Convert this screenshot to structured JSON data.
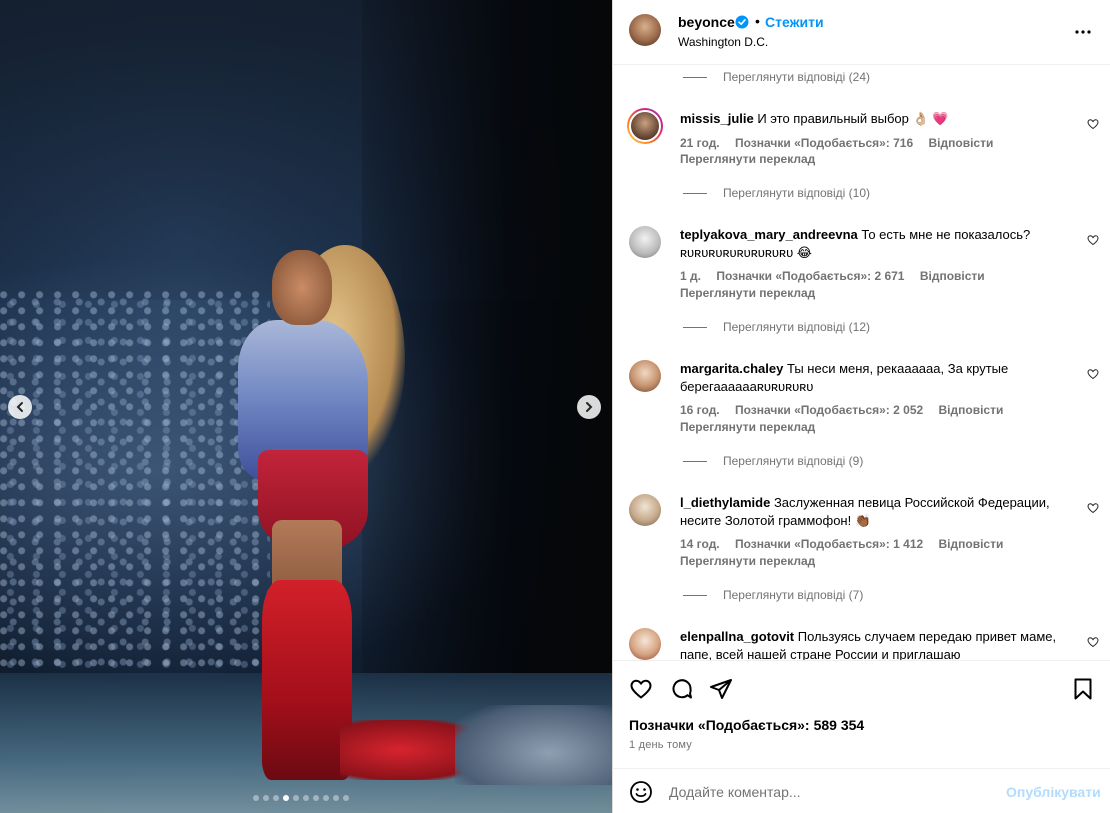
{
  "post": {
    "username": "beyonce",
    "follow_label": "Стежити",
    "separator": "•",
    "location": "Washington D.C."
  },
  "media": {
    "slides_total": 10,
    "active_slide": 4
  },
  "comments": [
    {
      "view_replies": "Переглянути відповіді (24)"
    },
    {
      "username": "missis_julie",
      "text": "И это правильный выбор 👌🏼 💗",
      "time": "21 год.",
      "likes": "Позначки «Подобається»: 716",
      "reply": "Відповісти",
      "translate": "Переглянути переклад",
      "view_replies": "Переглянути відповіді (10)"
    },
    {
      "username": "teplyakova_mary_andreevna",
      "text": "То есть мне не показалось? ʀᴜʀᴜʀᴜʀᴜʀᴜʀᴜʀᴜʀᴜ 😂",
      "time": "1 д.",
      "likes": "Позначки «Подобається»: 2 671",
      "reply": "Відповісти",
      "translate": "Переглянути переклад",
      "view_replies": "Переглянути відповіді (12)"
    },
    {
      "username": "margarita.chaley",
      "text": "Ты неси меня, рекаааааа, За крутые берегааааааʀᴜʀᴜʀᴜʀᴜ",
      "time": "16 год.",
      "likes": "Позначки «Подобається»: 2 052",
      "reply": "Відповісти",
      "translate": "Переглянути переклад",
      "view_replies": "Переглянути відповіді (9)"
    },
    {
      "username": "l_diethylamide",
      "text": "Заслуженная певица Российской Федерации, несите Золотой граммофон! 👏🏾",
      "time": "14 год.",
      "likes": "Позначки «Подобається»: 1 412",
      "reply": "Відповісти",
      "translate": "Переглянути переклад",
      "view_replies": "Переглянути відповіді (7)"
    },
    {
      "username": "elenpallna_gotovit",
      "text": "Пользуясь случаем передаю привет маме, папе, всей нашей стране России и приглашаю"
    }
  ],
  "footer": {
    "likes_label": "Позначки «Подобається»:",
    "likes_count": "589 354",
    "time_ago": "1 день тому",
    "comment_placeholder": "Додайте коментар...",
    "publish_label": "Опублікувати"
  },
  "colors": {
    "accent": "#0095f6",
    "muted": "#737373",
    "publish_disabled": "#b3dbff",
    "heart_emoji": "#e9457a"
  },
  "icons": {
    "verified": "verified-badge-icon",
    "more": "more-dots-icon",
    "like": "heart-icon",
    "comment": "comment-icon",
    "share": "share-icon",
    "save": "bookmark-icon",
    "emoji": "emoji-icon",
    "prev": "chevron-left-icon",
    "next": "chevron-right-icon"
  }
}
